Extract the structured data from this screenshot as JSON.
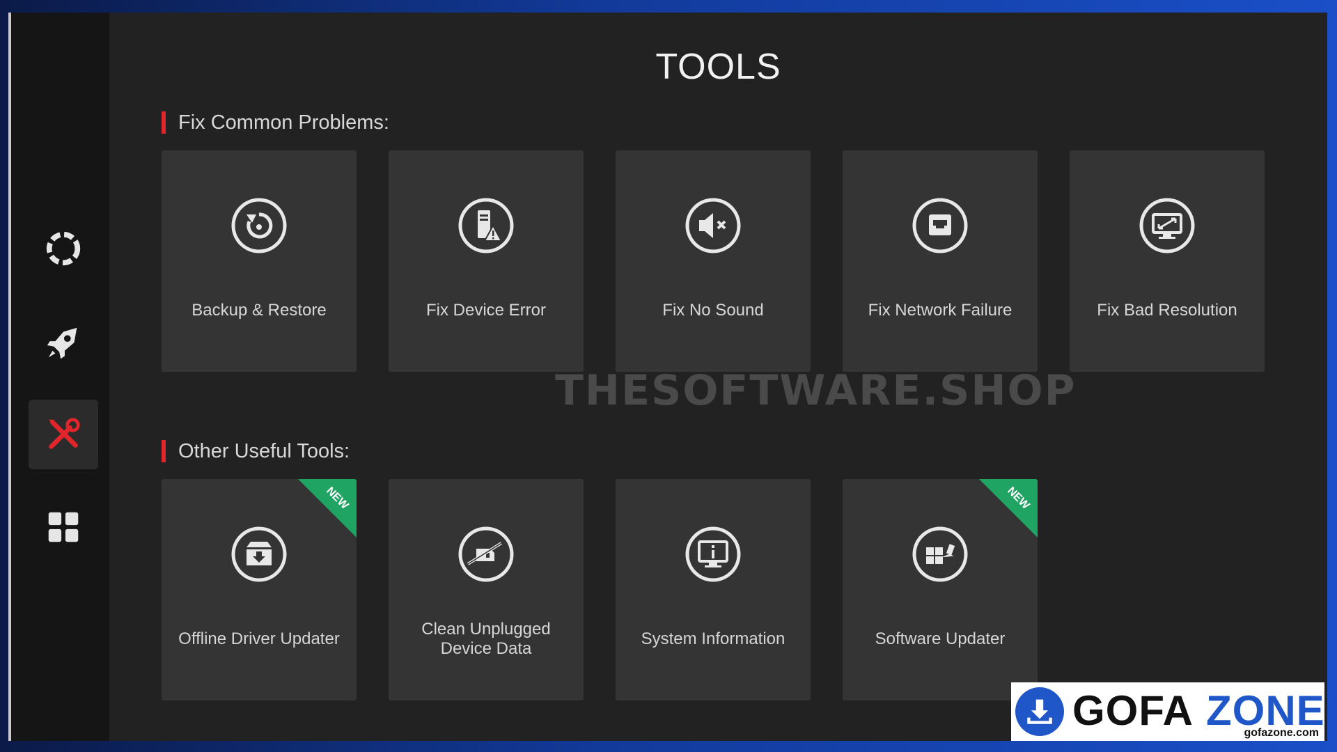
{
  "page": {
    "title": "TOOLS"
  },
  "sidebar": {
    "items": [
      {
        "icon": "scan-ring-icon",
        "active": false
      },
      {
        "icon": "rocket-icon",
        "active": false
      },
      {
        "icon": "tools-icon",
        "active": true
      },
      {
        "icon": "grid-apps-icon",
        "active": false
      }
    ]
  },
  "sections": {
    "fix_common": {
      "title": "Fix Common Problems:",
      "cards": [
        {
          "label": "Backup & Restore",
          "icon": "backup-restore-icon"
        },
        {
          "label": "Fix Device Error",
          "icon": "device-error-icon"
        },
        {
          "label": "Fix No Sound",
          "icon": "no-sound-icon"
        },
        {
          "label": "Fix Network Failure",
          "icon": "network-failure-icon"
        },
        {
          "label": "Fix Bad Resolution",
          "icon": "resolution-icon"
        }
      ]
    },
    "other_tools": {
      "title": "Other Useful Tools:",
      "cards": [
        {
          "label": "Offline Driver Updater",
          "icon": "offline-driver-icon",
          "badge": "NEW"
        },
        {
          "label": "Clean Unplugged Device Data",
          "icon": "clean-device-icon"
        },
        {
          "label": "System Information",
          "icon": "system-info-icon"
        },
        {
          "label": "Software Updater",
          "icon": "software-updater-icon",
          "badge": "NEW"
        }
      ]
    }
  },
  "watermark": "THESOFTWARE.SHOP",
  "logo": {
    "word_a": "GOFA",
    "word_b": "ZONE",
    "sub": "gofazone.com"
  },
  "colors": {
    "accent_red": "#e0252b",
    "badge_green": "#1fa463",
    "logo_blue": "#1f57c8"
  }
}
